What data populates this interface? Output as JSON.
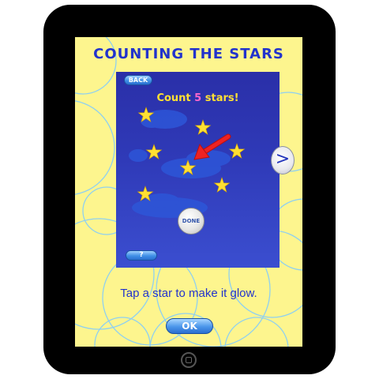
{
  "game": {
    "title": "COUNTING THE STARS",
    "back_label": "BACK",
    "prompt_prefix": "Count ",
    "prompt_number": "5",
    "prompt_suffix": " stars!",
    "done_label": "DONE",
    "help_label": "?",
    "next_label": ">",
    "instruction": "Tap a star to make it glow.",
    "ok_label": "OK"
  },
  "stars": [
    {
      "name": "star",
      "glowing": false
    },
    {
      "name": "star",
      "glowing": false
    },
    {
      "name": "star",
      "glowing": false
    },
    {
      "name": "star",
      "glowing": false
    },
    {
      "name": "star",
      "glowing": false
    },
    {
      "name": "star",
      "glowing": false
    },
    {
      "name": "star",
      "glowing": false
    }
  ],
  "colors": {
    "background": "#fdf58e",
    "title": "#2233cc",
    "panel": "#2f3ab8",
    "star": "#ffe033",
    "arrow": "#ee2222",
    "number_highlight": "#ff66cc",
    "button": "#3f8fe6"
  },
  "icons": {
    "pointer": "red-arrow-icon",
    "next": "chevron-right-icon",
    "home": "home-button-icon"
  }
}
